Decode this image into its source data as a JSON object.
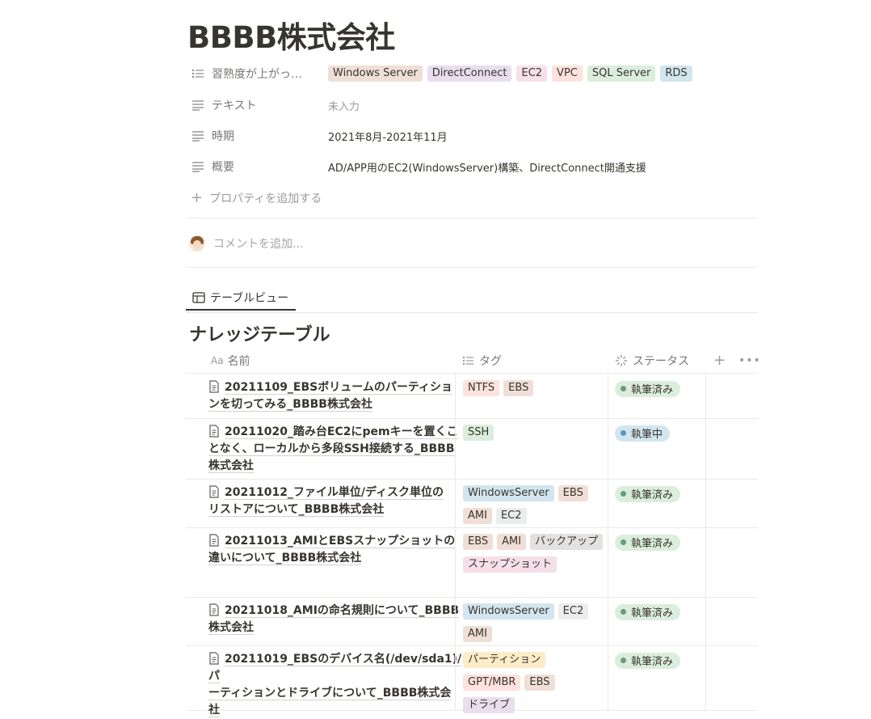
{
  "page": {
    "title": "BBBB株式会社",
    "properties": [
      {
        "name": "習熟度が上がっ…",
        "icon": "list-icon",
        "type": "tags",
        "tags": [
          {
            "label": "Windows Server",
            "color": "#f0dfd6"
          },
          {
            "label": "DirectConnect",
            "color": "#e8deee"
          },
          {
            "label": "EC2",
            "color": "#f5e0e9"
          },
          {
            "label": "VPC",
            "color": "#ffe2dd"
          },
          {
            "label": "SQL Server",
            "color": "#dbeddb"
          },
          {
            "label": "RDS",
            "color": "#d3e5ef"
          }
        ]
      },
      {
        "name": "テキスト",
        "icon": "text-icon",
        "type": "text",
        "value": "未入力",
        "empty": true
      },
      {
        "name": "時期",
        "icon": "text-icon",
        "type": "text",
        "value": "2021年8月-2021年11月"
      },
      {
        "name": "概要",
        "icon": "text-icon",
        "type": "text",
        "value": "AD/APP用のEC2(WindowsServer)構築、DirectConnect開通支援"
      }
    ],
    "add_property_label": "プロパティを追加する",
    "comment_placeholder": "コメントを追加..."
  },
  "view": {
    "tab_label": "テーブルビュー"
  },
  "database": {
    "title": "ナレッジテーブル",
    "columns": {
      "name": "名前",
      "name_prefix": "Aa",
      "tags": "タグ",
      "status": "ステータス"
    },
    "status_colors": {
      "執筆済み": {
        "bg": "#dbeddb",
        "dot": "#6c9b7d"
      },
      "執筆中": {
        "bg": "#d3e5ef",
        "dot": "#5b97bd"
      }
    },
    "rows": [
      {
        "title": "20211109_EBSボリュームのパーティションを切ってみる_BBBB株式会社",
        "lines": [
          "20211109_EBSボリュームのパーティショ",
          "ンを切ってみる_BBBB株式会社"
        ],
        "tags": [
          {
            "label": "NTFS",
            "color": "#ffe2dd"
          },
          {
            "label": "EBS",
            "color": "#f0dfd6"
          }
        ],
        "status": "執筆済み"
      },
      {
        "title": "20211020_踏み台EC2にpemキーを置くことなく、ローカルから多段SSH接続する_BBBB株式会社",
        "lines": [
          "20211020_踏み台EC2にpemキーを置くこ",
          "となく、ローカルから多段SSH接続する_BBBB",
          "株式会社"
        ],
        "tags": [
          {
            "label": "SSH",
            "color": "#dbeddb"
          }
        ],
        "status": "執筆中"
      },
      {
        "title": "20211012_ファイル単位/ディスク単位のリストアについて_BBBB株式会社",
        "lines": [
          "20211012_ファイル単位/ディスク単位の",
          "リストアについて_BBBB株式会社"
        ],
        "tags": [
          {
            "label": "WindowsServer",
            "color": "#d3e5ef"
          },
          {
            "label": "EBS",
            "color": "#f0dfd6"
          },
          {
            "label": "AMI",
            "color": "#f0dfd6"
          },
          {
            "label": "EC2",
            "color": "#ebeced"
          }
        ],
        "status": "執筆済み"
      },
      {
        "title": "20211013_AMIとEBSスナップショットの違いについて_BBBB株式会社",
        "lines": [
          "20211013_AMIとEBSスナップショットの",
          "違いについて_BBBB株式会社"
        ],
        "tags": [
          {
            "label": "EBS",
            "color": "#f0dfd6"
          },
          {
            "label": "AMI",
            "color": "#f0dfd6"
          },
          {
            "label": "バックアップ",
            "color": "#e3e2e0"
          },
          {
            "label": "スナップショット",
            "color": "#f5e0e9"
          }
        ],
        "status": "執筆済み"
      },
      {
        "title": "20211018_AMIの命名規則について_BBBB株式会社",
        "lines": [
          "20211018_AMIの命名規則について_BBBB",
          "株式会社"
        ],
        "tags": [
          {
            "label": "WindowsServer",
            "color": "#d3e5ef"
          },
          {
            "label": "EC2",
            "color": "#ebeced"
          },
          {
            "label": "AMI",
            "color": "#f0dfd6"
          }
        ],
        "status": "執筆済み"
      },
      {
        "title": "20211019_EBSのデバイス名(/dev/sda1)/パーティションとドライブについて_BBBB株式会社",
        "lines": [
          "20211019_EBSのデバイス名(/dev/sda1)/パ",
          "ーティションとドライブについて_BBBB株式会",
          "社"
        ],
        "tags": [
          {
            "label": "パーティション",
            "color": "#fdecc8"
          },
          {
            "label": "GPT/MBR",
            "color": "#ffe2dd"
          },
          {
            "label": "EBS",
            "color": "#f0dfd6"
          },
          {
            "label": "ドライブ",
            "color": "#e8deee"
          }
        ],
        "status": "執筆済み"
      }
    ]
  }
}
